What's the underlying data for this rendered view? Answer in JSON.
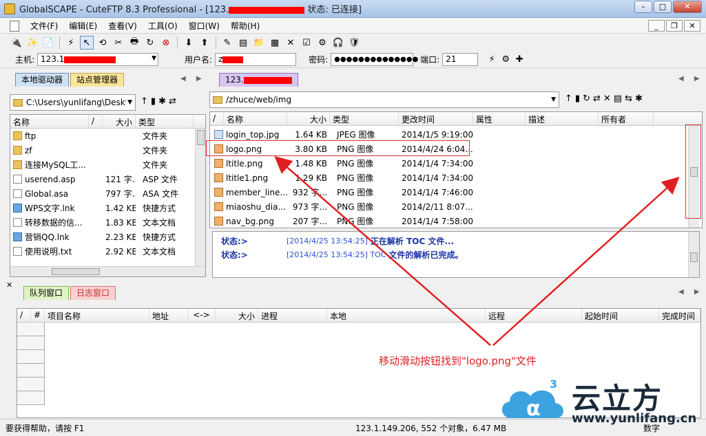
{
  "window": {
    "title_prefix": "GlobalSCAPE - CuteFTP 8.3 Professional - [123.",
    "title_suffix": "状态: 已连接]",
    "controls": [
      "–",
      "□",
      "✕"
    ]
  },
  "menu": {
    "items": [
      "文件(F)",
      "编辑(E)",
      "查看(V)",
      "工具(O)",
      "窗口(W)",
      "帮助(H)"
    ]
  },
  "quick_connect": {
    "host_label": "主机:",
    "host_value": "123.1",
    "user_label": "用户名:",
    "user_value": "z",
    "pass_label": "密码:",
    "pass_value": "●●●●●●●●●●●●●●",
    "port_label": "端口:",
    "port_value": "21"
  },
  "local": {
    "tabs": [
      "本地驱动器",
      "站点管理器"
    ],
    "path": "C:\\Users\\yunlifang\\Deskt",
    "columns": [
      "名称",
      "/",
      "大小",
      "类型"
    ],
    "rows": [
      {
        "icon": "folder",
        "name": "ftp",
        "size": "",
        "type": "文件夹"
      },
      {
        "icon": "folder",
        "name": "zf",
        "size": "",
        "type": "文件夹"
      },
      {
        "icon": "folder",
        "name": "连接MySQL工...",
        "size": "",
        "type": "文件夹"
      },
      {
        "icon": "file",
        "name": "userend.asp",
        "size": "121 字...",
        "type": "ASP 文件"
      },
      {
        "icon": "file",
        "name": "Global.asa",
        "size": "797 字...",
        "type": "ASA 文件"
      },
      {
        "icon": "lnk",
        "name": "WPS文字.lnk",
        "size": "1.42 KB",
        "type": "快捷方式"
      },
      {
        "icon": "file",
        "name": "转移数据的信...",
        "size": "1.83 KB",
        "type": "文本文档"
      },
      {
        "icon": "lnk",
        "name": "营销QQ.lnk",
        "size": "2.23 KB",
        "type": "快捷方式"
      },
      {
        "icon": "file",
        "name": "使用说明.txt",
        "size": "2.92 KB",
        "type": "文本文档"
      }
    ]
  },
  "remote": {
    "tab_prefix": "123.",
    "path": "/zhuce/web/img",
    "columns": [
      "/",
      "名称",
      "大小",
      "类型",
      "更改时间",
      "属性",
      "描述",
      "所有者"
    ],
    "rows": [
      {
        "icon": "jpg",
        "name": "login_top.jpg",
        "size": "1.64 KB",
        "type": "JPEG 图像",
        "time": "2014/1/5 9:19:00"
      },
      {
        "icon": "img",
        "name": "logo.png",
        "size": "3.80 KB",
        "type": "PNG 图像",
        "time": "2014/4/24 6:04..."
      },
      {
        "icon": "img",
        "name": "ltitle.png",
        "size": "1.48 KB",
        "type": "PNG 图像",
        "time": "2014/1/4 7:34:00"
      },
      {
        "icon": "img",
        "name": "ltitle1.png",
        "size": "1.29 KB",
        "type": "PNG 图像",
        "time": "2014/1/4 7:34:00"
      },
      {
        "icon": "img",
        "name": "member_line....",
        "size": "932 字...",
        "type": "PNG 图像",
        "time": "2014/1/4 7:46:00"
      },
      {
        "icon": "img",
        "name": "miaoshu_dia...",
        "size": "973 字...",
        "type": "PNG 图像",
        "time": "2014/2/11 8:07..."
      },
      {
        "icon": "img",
        "name": "nav_bg.png",
        "size": "207 字...",
        "type": "PNG 图像",
        "time": "2014/1/4 7:58:00"
      }
    ]
  },
  "log": [
    {
      "status": "状态:>",
      "time": "[2014/4/25 13:54:25]",
      "msg": "正在解析 TOC 文件..."
    },
    {
      "status": "状态:>",
      "time": "[2014/4/25 13:54:25] TOC",
      "msg": "文件的解析已完成。"
    }
  ],
  "queue": {
    "tabs": [
      "队列窗口",
      "日志窗口"
    ],
    "columns": [
      "/",
      "#",
      "项目名称",
      "地址",
      "<->",
      "大小",
      "进程",
      "本地",
      "远程",
      "起始时间",
      "完成时间"
    ]
  },
  "status_bar": {
    "help": "要获得帮助，请按 F1",
    "info": "123.1.149.206, 552 个对象，6.47 MB",
    "mode": "数字"
  },
  "annotation": {
    "text": "移动滑动按钮找到\"logo.png\"文件",
    "color": "#e02020"
  },
  "watermark": {
    "brand": "云立方",
    "url": "www.yunlifang.cn"
  }
}
